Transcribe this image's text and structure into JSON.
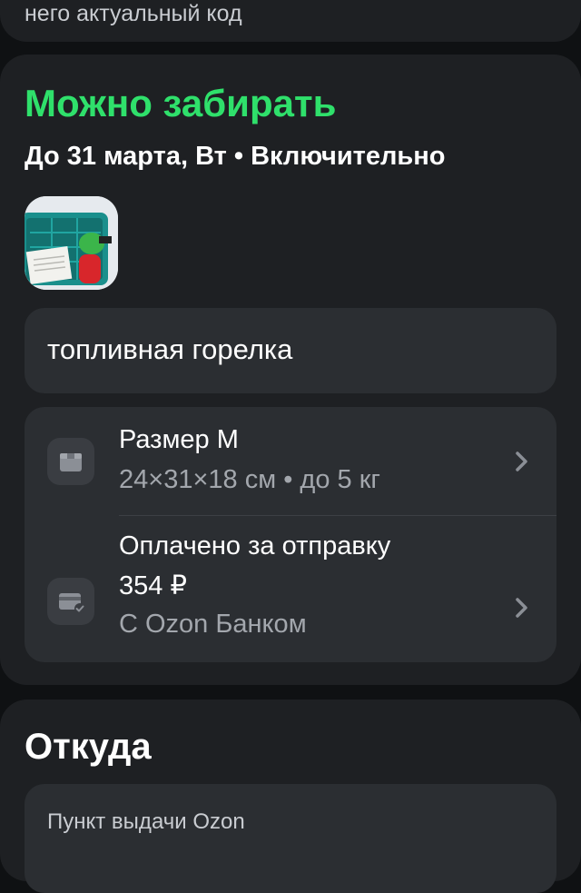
{
  "top_card": {
    "tail_text": "него актуальный код"
  },
  "status": {
    "title": "Можно забирать",
    "subtitle": "До 31 марта, Вт • Включительно",
    "status_color": "#2fe06b"
  },
  "item": {
    "name": "топливная горелка"
  },
  "details": [
    {
      "icon": "box-icon",
      "title": "Размер M",
      "subtitle": "24×31×18 см • до 5 кг"
    },
    {
      "icon": "card-paid-icon",
      "title": "Оплачено за отправку",
      "amount": "354 ₽",
      "subtitle": "С Ozon Банком"
    }
  ],
  "from_section": {
    "title": "Откуда",
    "pickup_label": "Пункт выдачи Ozon"
  }
}
